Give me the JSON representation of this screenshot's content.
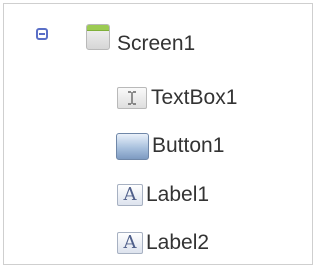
{
  "tree": {
    "root": {
      "label": "Screen1",
      "icon": "screen-icon",
      "expanded": true,
      "toggle_icon": "collapse-minus-icon"
    },
    "children": [
      {
        "label": "TextBox1",
        "icon": "textbox-icon"
      },
      {
        "label": "Button1",
        "icon": "button-icon"
      },
      {
        "label": "Label1",
        "icon": "label-icon"
      },
      {
        "label": "Label2",
        "icon": "label-icon"
      }
    ]
  },
  "colors": {
    "toggle": "#5a6fc7",
    "screen_bar": "#9ccb53",
    "button_gradient_bottom": "#7d9ac1",
    "label_letter": "#4f5f8a",
    "text": "#333333"
  }
}
